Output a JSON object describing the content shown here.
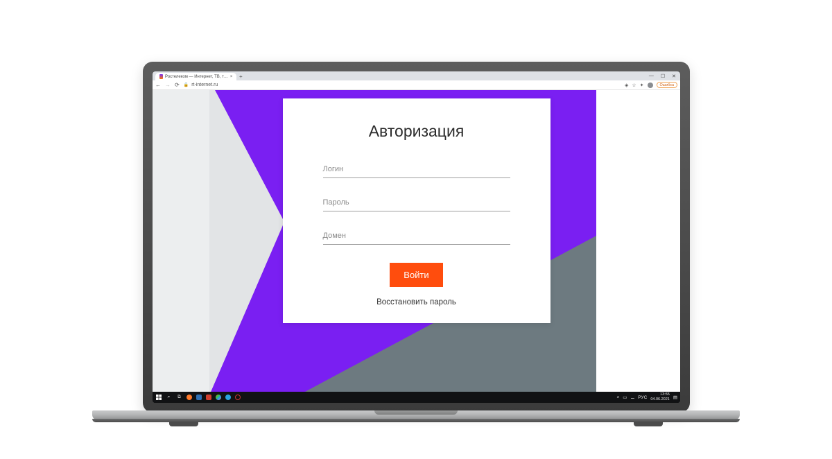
{
  "browser": {
    "tab_title": "Ростелеком — Интернет, ТВ, т…",
    "url": "rt-internet.ru",
    "window_controls": {
      "min": "—",
      "max": "☐",
      "close": "✕"
    },
    "nav": {
      "back": "←",
      "forward": "→",
      "reload": "⟳"
    },
    "error_chip": "Ошибка"
  },
  "login": {
    "title": "Авторизация",
    "fields": {
      "login_label": "Логин",
      "password_label": "Пароль",
      "domain_label": "Домен"
    },
    "submit": "Войти",
    "recover": "Восстановить пароль"
  },
  "taskbar": {
    "lang": "РУС",
    "time": "13:55",
    "date": "04.06.2021",
    "tray_up": "˄"
  },
  "colors": {
    "purple": "#7a1ff2",
    "orange": "#ff4d0d",
    "slate": "#6d7a80"
  }
}
